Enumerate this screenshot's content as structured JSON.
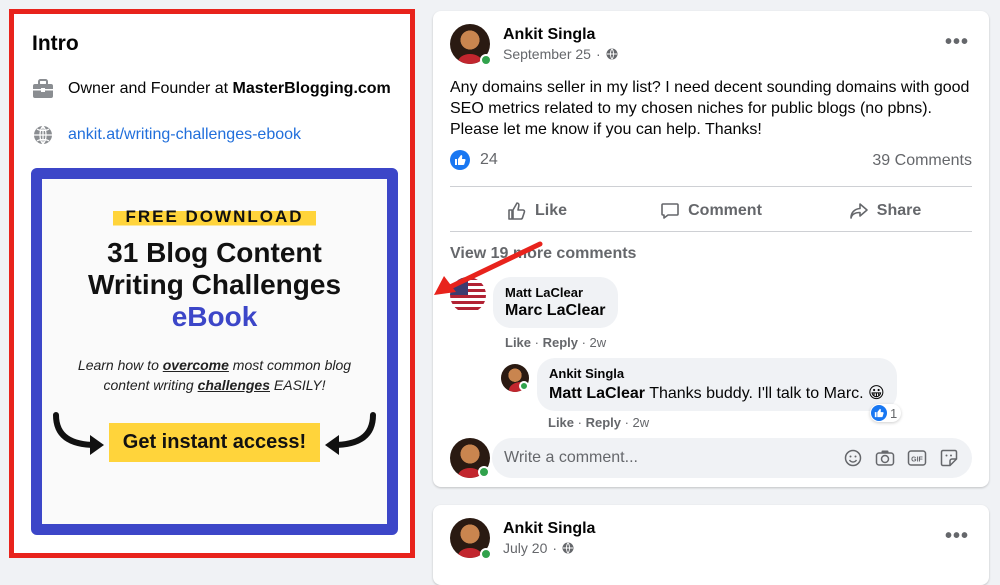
{
  "intro": {
    "title": "Intro",
    "work_prefix": "Owner and Founder at ",
    "work_company": "MasterBlogging.com",
    "website": "ankit.at/writing-challenges-ebook",
    "promo": {
      "highlight": "FREE DOWNLOAD",
      "title_line1": "31 Blog Content",
      "title_line2": "Writing Challenges",
      "title_line3": "eBook",
      "desc_p1": "Learn how to ",
      "desc_u1": "overcome",
      "desc_p2": " most common blog content writing ",
      "desc_u2": "challenges",
      "desc_p3": " EASILY!",
      "cta": "Get instant access!"
    }
  },
  "post1": {
    "author": "Ankit Singla",
    "date": "September 25",
    "text": "Any domains seller in my list? I need decent sounding domains with good SEO metrics related to my chosen niches for public blogs (no pbns). Please let me know if you can help. Thanks!",
    "reactions_count": "24",
    "comments_count": "39 Comments",
    "actions": {
      "like": "Like",
      "comment": "Comment",
      "share": "Share"
    },
    "view_more": "View 19 more comments",
    "comment1": {
      "name": "Matt LaClear",
      "text": "Marc LaClear",
      "like": "Like",
      "reply": "Reply",
      "time": "2w"
    },
    "reply1": {
      "name": "Ankit Singla",
      "mention": "Matt LaClear",
      "text": " Thanks buddy. I'll talk to Marc. 😀",
      "like": "Like",
      "reply": "Reply",
      "time": "2w",
      "reaction_count": "1"
    },
    "write_placeholder": "Write a comment..."
  },
  "post2": {
    "author": "Ankit Singla",
    "date": "July 20"
  },
  "colors": {
    "highlight_border": "#e8231c",
    "promo_border": "#3c46c8",
    "promo_yellow": "#ffd43b",
    "facebook_blue": "#1877f2",
    "link": "#216fdb"
  }
}
